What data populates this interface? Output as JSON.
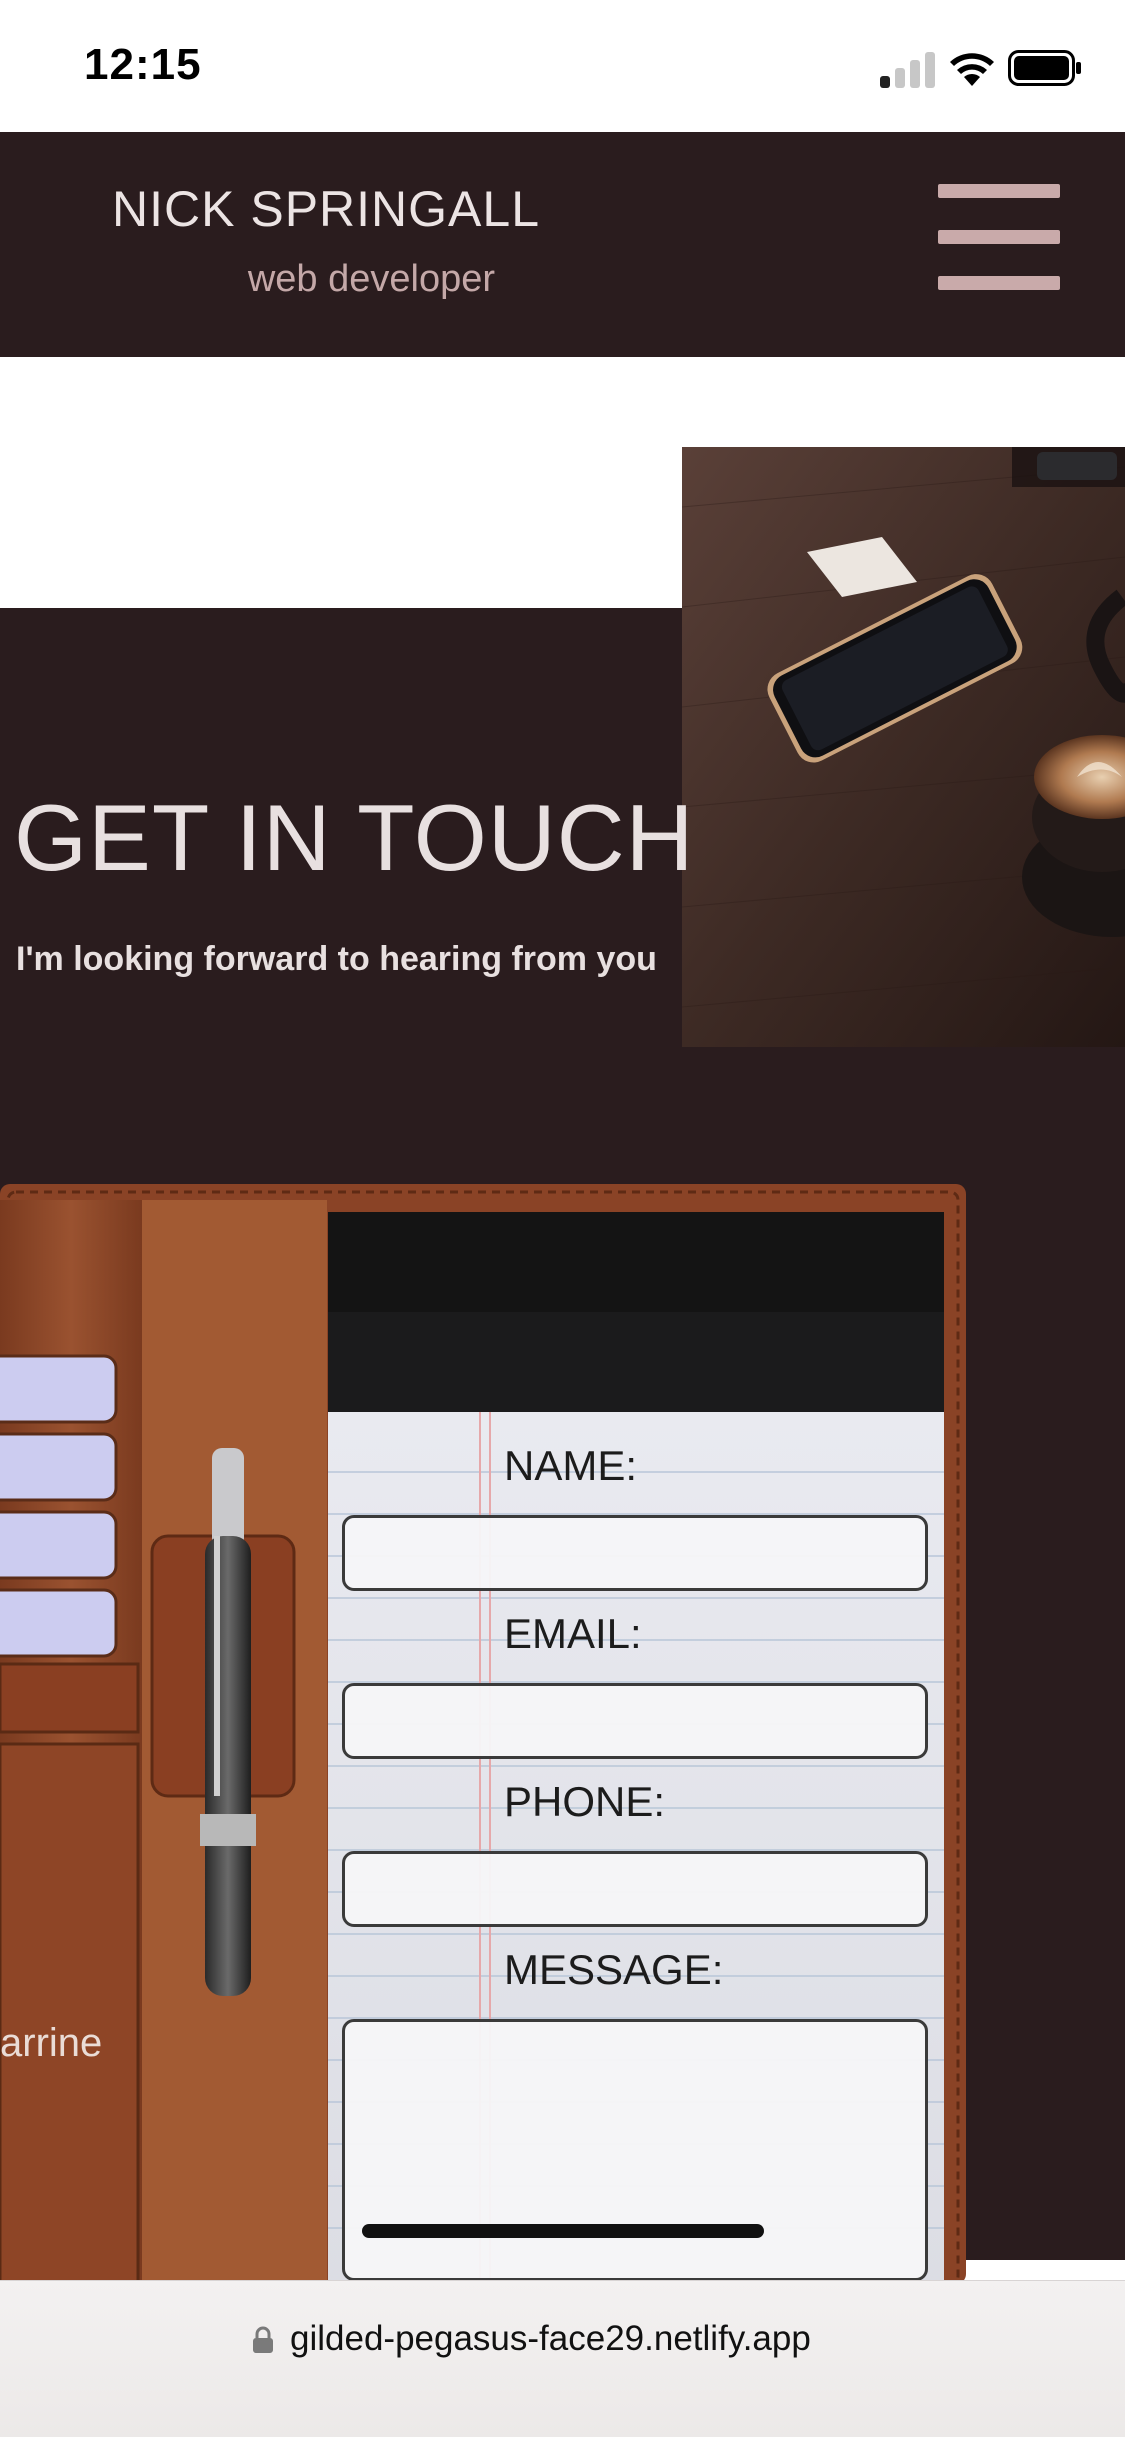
{
  "status_bar": {
    "time": "12:15"
  },
  "header": {
    "name": "NICK SPRINGALL",
    "role": "web developer"
  },
  "hero": {
    "title": "GET IN TOUCH",
    "subtitle": "I'm looking forward to hearing from you"
  },
  "notebook": {
    "card_text": "arrine"
  },
  "form": {
    "name_label": "NAME:",
    "email_label": "EMAIL:",
    "phone_label": "PHONE:",
    "message_label": "MESSAGE:",
    "name_value": "",
    "email_value": "",
    "phone_value": "",
    "message_value": ""
  },
  "browser": {
    "url": "gilded-pegasus-face29.netlify.app"
  },
  "colors": {
    "dark_bg": "#2a1c1e",
    "accent_pink": "#c9aaaa",
    "leather": "#8a4326"
  }
}
